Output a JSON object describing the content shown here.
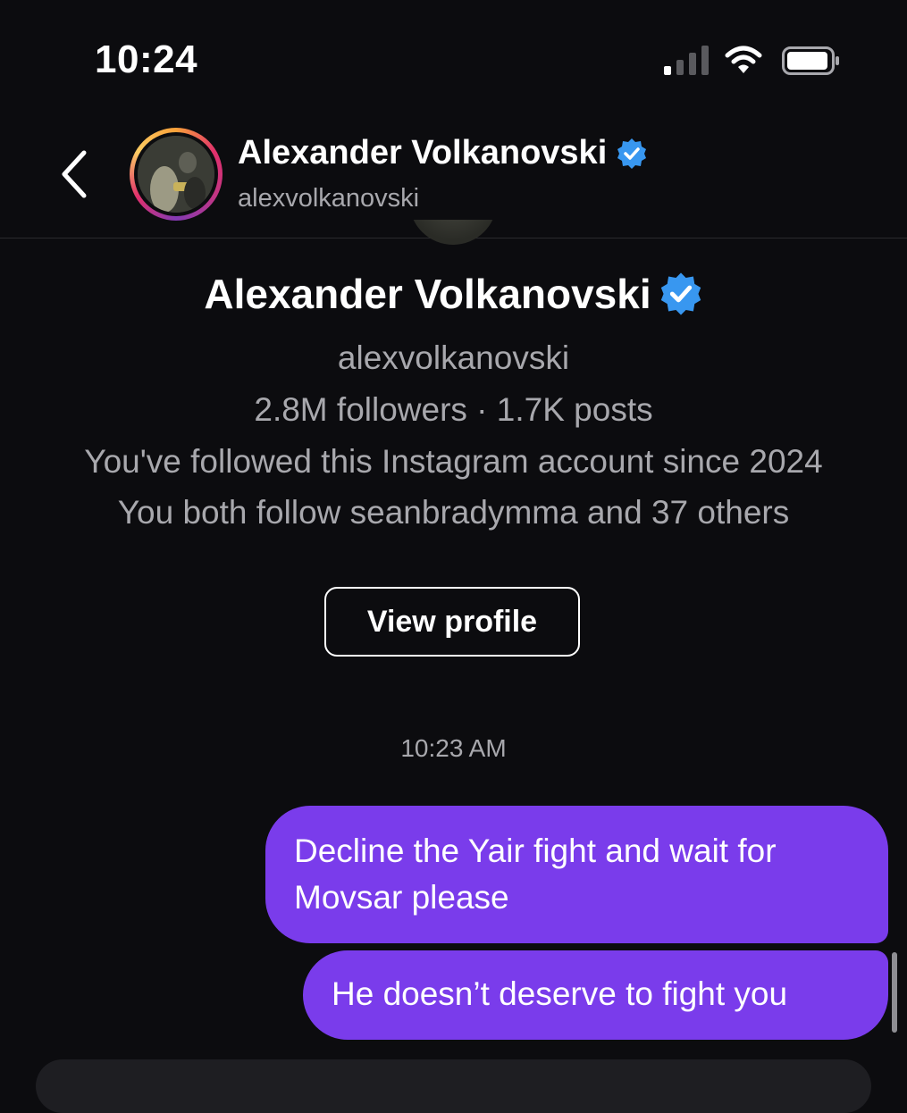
{
  "status_bar": {
    "time": "10:24",
    "icons": [
      "cellular-signal-icon",
      "wifi-icon",
      "battery-icon"
    ]
  },
  "header": {
    "name": "Alexander Volkanovski",
    "handle": "alexvolkanovski",
    "verified": true,
    "back_icon": "chevron-left-icon"
  },
  "profile": {
    "name": "Alexander Volkanovski",
    "handle": "alexvolkanovski",
    "stats": "2.8M followers · 1.7K posts",
    "followed_since": "You've followed this Instagram account since 2024",
    "mutuals": "You both follow seanbradymma and 37 others",
    "view_profile_label": "View profile"
  },
  "conversation": {
    "timestamp": "10:23 AM",
    "messages": [
      {
        "sender": "me",
        "text": "Decline the Yair fight and wait for Movsar please"
      },
      {
        "sender": "me",
        "text": "He doesn’t deserve to fight you"
      }
    ]
  },
  "colors": {
    "background": "#0c0c0f",
    "bubble": "#7a3ceb",
    "verified_badge": "#3897f0",
    "secondary_text": "#a8a8ad"
  }
}
